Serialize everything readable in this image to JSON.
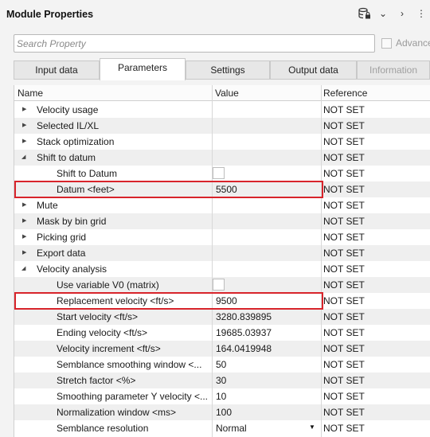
{
  "window": {
    "title": "Module Properties"
  },
  "toolbar_icons": [
    "database-lock-icon",
    "chevron-down-icon",
    "chevron-right-icon",
    "more-icon"
  ],
  "search": {
    "placeholder": "Search Property",
    "advanced_label": "Advance"
  },
  "tabs": [
    {
      "label": "Input data",
      "state": "normal"
    },
    {
      "label": "Parameters",
      "state": "active"
    },
    {
      "label": "Settings",
      "state": "normal"
    },
    {
      "label": "Output data",
      "state": "normal"
    },
    {
      "label": "Information",
      "state": "disabled"
    }
  ],
  "columns": {
    "name": "Name",
    "value": "Value",
    "reference": "Reference"
  },
  "rows": [
    {
      "name": "Velocity usage",
      "level": 0,
      "expander": "collapsed",
      "value": "",
      "reference": "NOT SET"
    },
    {
      "name": "Selected IL/XL",
      "level": 0,
      "expander": "collapsed",
      "value": "",
      "reference": "NOT SET"
    },
    {
      "name": "Stack optimization",
      "level": 0,
      "expander": "collapsed",
      "value": "",
      "reference": "NOT SET"
    },
    {
      "name": "Shift to datum",
      "level": 0,
      "expander": "expanded",
      "value": "",
      "reference": "NOT SET"
    },
    {
      "name": "Shift to Datum",
      "level": 1,
      "value_type": "checkbox",
      "checked": false,
      "value": "",
      "reference": "NOT SET"
    },
    {
      "name": "Datum <feet>",
      "level": 1,
      "value": "5500",
      "reference": "NOT SET",
      "highlighted": true
    },
    {
      "name": "Mute",
      "level": 0,
      "expander": "collapsed",
      "value": "",
      "reference": "NOT SET"
    },
    {
      "name": "Mask by bin grid",
      "level": 0,
      "expander": "collapsed",
      "value": "",
      "reference": "NOT SET"
    },
    {
      "name": "Picking grid",
      "level": 0,
      "expander": "collapsed",
      "value": "",
      "reference": "NOT SET"
    },
    {
      "name": "Export data",
      "level": 0,
      "expander": "collapsed",
      "value": "",
      "reference": "NOT SET"
    },
    {
      "name": "Velocity analysis",
      "level": 0,
      "expander": "expanded",
      "value": "",
      "reference": "NOT SET"
    },
    {
      "name": "Use variable V0 (matrix)",
      "level": 1,
      "value_type": "checkbox",
      "checked": false,
      "value": "",
      "reference": "NOT SET"
    },
    {
      "name": "Replacement velocity <ft/s>",
      "level": 1,
      "value": "9500",
      "reference": "NOT SET",
      "highlighted": true
    },
    {
      "name": "Start velocity <ft/s>",
      "level": 1,
      "value": "3280.839895",
      "reference": "NOT SET"
    },
    {
      "name": "Ending velocity <ft/s>",
      "level": 1,
      "value": "19685.03937",
      "reference": "NOT SET"
    },
    {
      "name": "Velocity increment <ft/s>",
      "level": 1,
      "value": "164.0419948",
      "reference": "NOT SET"
    },
    {
      "name": "Semblance smoothing window <...",
      "level": 1,
      "value": "50",
      "reference": "NOT SET"
    },
    {
      "name": "Stretch factor <%>",
      "level": 1,
      "value": "30",
      "reference": "NOT SET"
    },
    {
      "name": "Smoothing parameter Y velocity <...",
      "level": 1,
      "value": "10",
      "reference": "NOT SET"
    },
    {
      "name": "Normalization window <ms>",
      "level": 1,
      "value": "100",
      "reference": "NOT SET"
    },
    {
      "name": "Semblance resolution",
      "level": 1,
      "value_type": "dropdown",
      "value": "Normal",
      "reference": "NOT SET"
    }
  ],
  "colors": {
    "highlight": "#d8242b",
    "row_shade": "#efefef",
    "background": "#f3f3f3"
  }
}
